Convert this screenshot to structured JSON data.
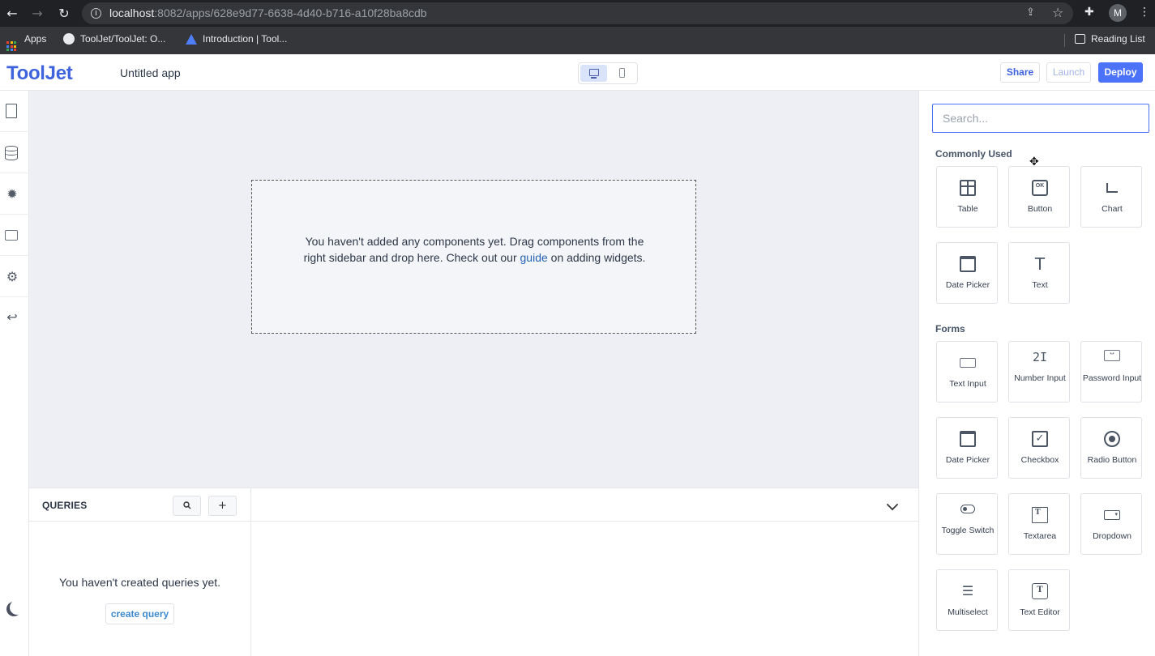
{
  "browser": {
    "url_host": "localhost",
    "url_rest": ":8082/apps/628e9d77-6638-4d40-b716-a10f28ba8cdb",
    "profile_initial": "M",
    "bookmarks": [
      {
        "label": "Apps",
        "icon": "apps-grid-icon"
      },
      {
        "label": "ToolJet/ToolJet: O...",
        "icon": "github-icon"
      },
      {
        "label": "Introduction | Tool...",
        "icon": "tooljet-docs-icon"
      }
    ],
    "reading_list": "Reading List"
  },
  "header": {
    "logo": "ToolJet",
    "app_name": "Untitled app",
    "share_label": "Share",
    "launch_label": "Launch",
    "deploy_label": "Deploy"
  },
  "canvas": {
    "empty_text_before": "You haven't added any components yet. Drag components from the right sidebar and drop here. Check out our ",
    "guide_link": "guide",
    "empty_text_after": " on adding widgets."
  },
  "queries": {
    "title": "QUERIES",
    "search_icon": "search-icon",
    "add_label": "+",
    "empty_text": "You haven't created queries yet.",
    "create_label": "create query"
  },
  "sidebar": {
    "search_placeholder": "Search...",
    "commonly_used_title": "Commonly Used",
    "commonly_used": [
      {
        "label": "Table",
        "icon": "table-icon"
      },
      {
        "label": "Button",
        "icon": "button-icon",
        "glyph": "OK"
      },
      {
        "label": "Chart",
        "icon": "chart-icon"
      },
      {
        "label": "Date Picker",
        "icon": "calendar-icon"
      },
      {
        "label": "Text",
        "icon": "text-icon",
        "glyph": "T"
      }
    ],
    "forms_title": "Forms",
    "forms": [
      {
        "label": "Text Input",
        "icon": "text-input-icon"
      },
      {
        "label": "Number Input",
        "icon": "number-input-icon",
        "glyph": "2I"
      },
      {
        "label": "Password Input",
        "icon": "password-input-icon",
        "glyph": "**"
      },
      {
        "label": "Date Picker",
        "icon": "calendar-icon"
      },
      {
        "label": "Checkbox",
        "icon": "checkbox-icon",
        "glyph": "✓"
      },
      {
        "label": "Radio Button",
        "icon": "radio-icon"
      },
      {
        "label": "Toggle Switch",
        "icon": "toggle-icon"
      },
      {
        "label": "Textarea",
        "icon": "textarea-icon",
        "glyph": "T"
      },
      {
        "label": "Dropdown",
        "icon": "dropdown-icon",
        "glyph": "▾"
      },
      {
        "label": "Multiselect",
        "icon": "multiselect-icon",
        "glyph": "☰"
      },
      {
        "label": "Text Editor",
        "icon": "text-editor-icon",
        "glyph": "T"
      }
    ]
  },
  "colors": {
    "brand": "#3e63dd",
    "deploy": "#4d72fa",
    "canvas_bg": "#edeff4"
  }
}
